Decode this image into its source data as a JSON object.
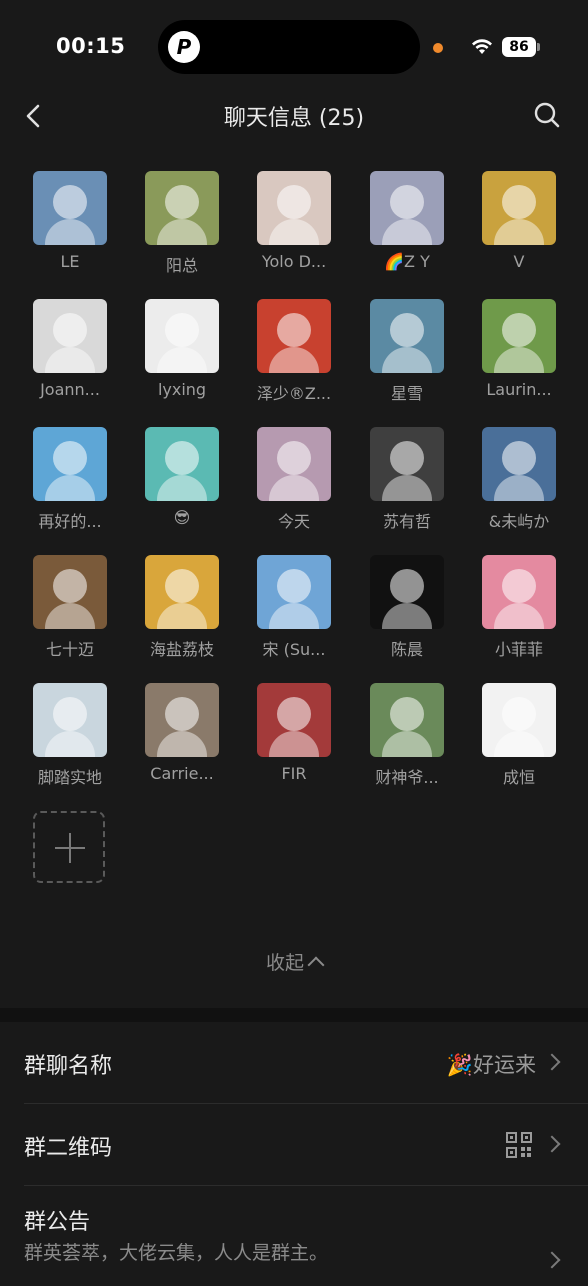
{
  "status_bar": {
    "time": "00:15",
    "battery": "86",
    "app_logo": "P"
  },
  "nav": {
    "title": "聊天信息 (25)"
  },
  "members": [
    {
      "name": "LE",
      "color": "#6a8fb5"
    },
    {
      "name": "阳总",
      "color": "#8a9a5a"
    },
    {
      "name": "Yolo D...",
      "color": "#d9c8c0"
    },
    {
      "name": "🌈Z Y",
      "color": "#9b9fb8"
    },
    {
      "name": "V",
      "color": "#c9a23e"
    },
    {
      "name": "Joann...",
      "color": "#d9d9d9"
    },
    {
      "name": "lyxing",
      "color": "#ececec"
    },
    {
      "name": "泽少®Z...",
      "color": "#c8412f"
    },
    {
      "name": "星雪",
      "color": "#5b8aa3"
    },
    {
      "name": "Laurin...",
      "color": "#6f9a4a"
    },
    {
      "name": "再好的...",
      "color": "#5ea6d6"
    },
    {
      "name": "😎",
      "color": "#5bbab3"
    },
    {
      "name": "今天",
      "color": "#b69ab0"
    },
    {
      "name": "苏有哲",
      "color": "#3f3f3f"
    },
    {
      "name": "&未屿か",
      "color": "#4a6f99"
    },
    {
      "name": "七十迈",
      "color": "#7a5a3a"
    },
    {
      "name": "海盐荔枝",
      "color": "#d9a63b"
    },
    {
      "name": "宋 (Su...",
      "color": "#6fa5d6"
    },
    {
      "name": "陈晨",
      "color": "#111111"
    },
    {
      "name": "小菲菲",
      "color": "#e48aa0"
    },
    {
      "name": "脚踏实地",
      "color": "#c9d6de"
    },
    {
      "name": "Carrie...",
      "color": "#8a7a6a"
    },
    {
      "name": "FIR",
      "color": "#a33a3a"
    },
    {
      "name": "财神爷...",
      "color": "#6a8a5a"
    },
    {
      "name": "成恒",
      "color": "#f2f2f2"
    }
  ],
  "collapse_label": "收起",
  "settings": {
    "group_name_label": "群聊名称",
    "group_name_value": "🎉好运来",
    "qr_label": "群二维码",
    "notice_label": "群公告",
    "notice_text": "群英荟萃，大佬云集，人人是群主。"
  }
}
